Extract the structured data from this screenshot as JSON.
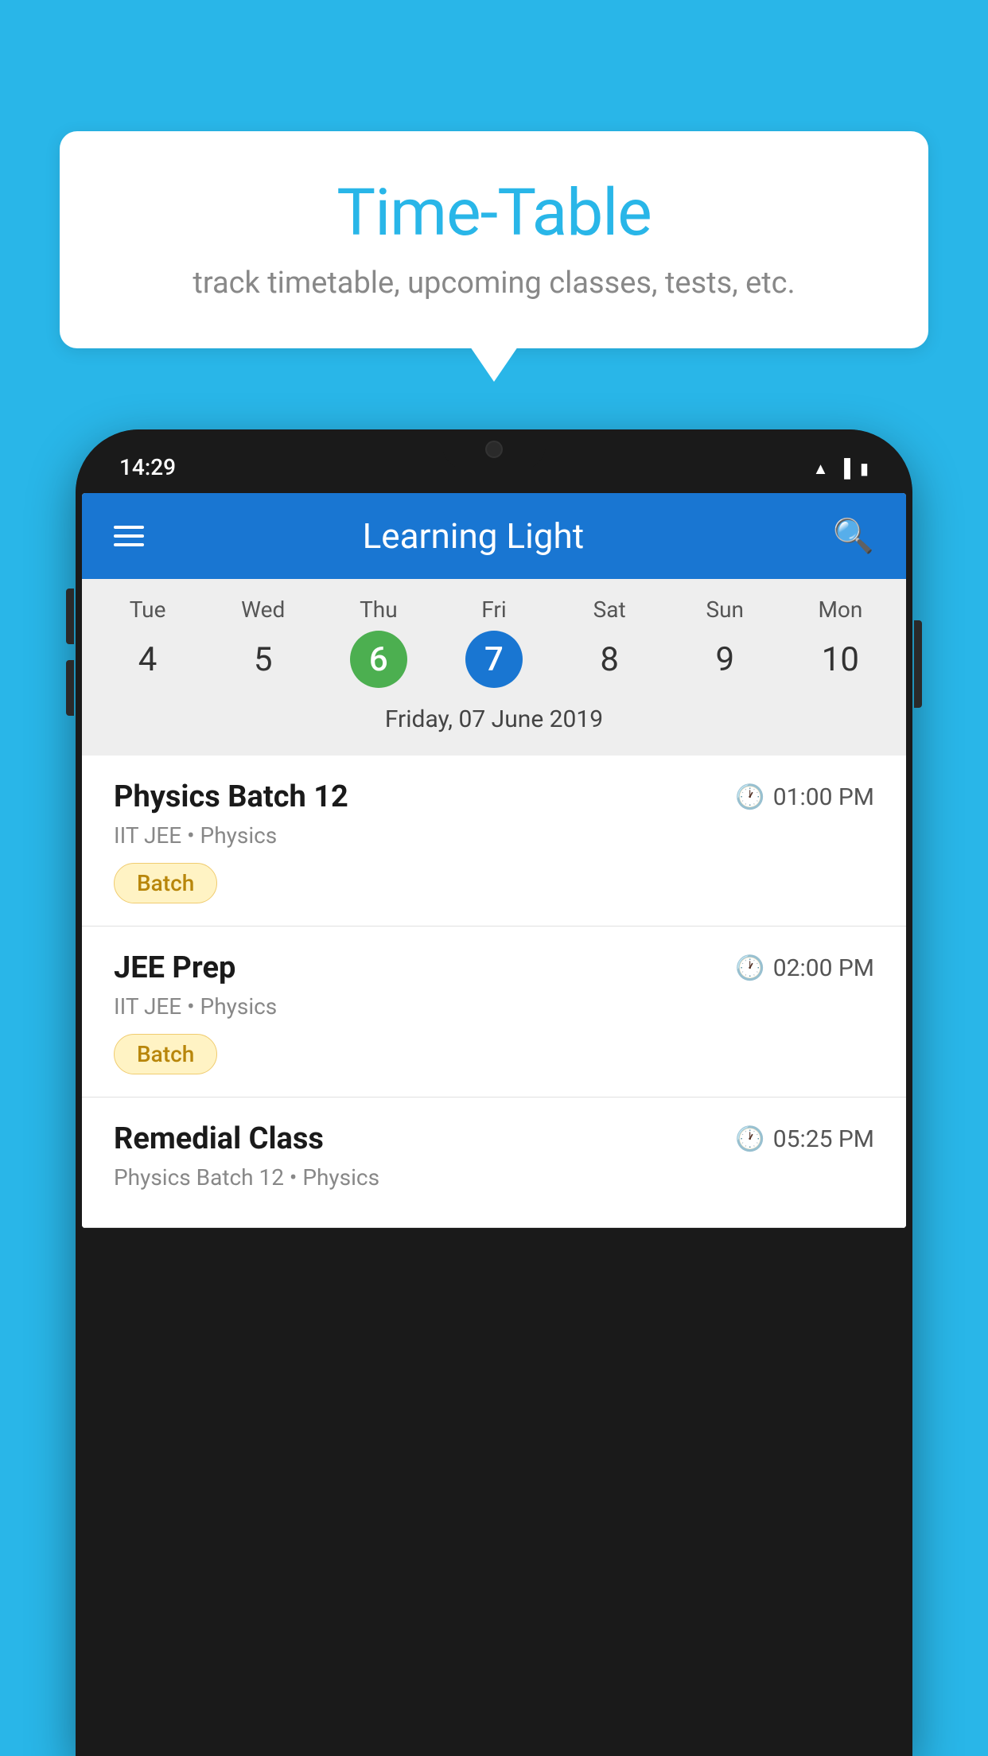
{
  "background_color": "#29B6E8",
  "bubble": {
    "title": "Time-Table",
    "subtitle": "track timetable, upcoming classes, tests, etc."
  },
  "phone": {
    "status_bar": {
      "time": "14:29"
    },
    "app_header": {
      "title": "Learning Light"
    },
    "calendar": {
      "days": [
        "Tue",
        "Wed",
        "Thu",
        "Fri",
        "Sat",
        "Sun",
        "Mon"
      ],
      "dates": [
        "4",
        "5",
        "6",
        "7",
        "8",
        "9",
        "10"
      ],
      "today_index": 2,
      "selected_index": 3,
      "selected_date_label": "Friday, 07 June 2019"
    },
    "schedule": [
      {
        "title": "Physics Batch 12",
        "time": "01:00 PM",
        "subtitle": "IIT JEE • Physics",
        "tag": "Batch"
      },
      {
        "title": "JEE Prep",
        "time": "02:00 PM",
        "subtitle": "IIT JEE • Physics",
        "tag": "Batch"
      },
      {
        "title": "Remedial Class",
        "time": "05:25 PM",
        "subtitle": "Physics Batch 12 • Physics",
        "tag": ""
      }
    ]
  }
}
